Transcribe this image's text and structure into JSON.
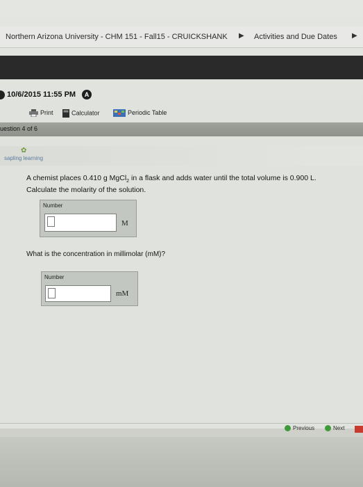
{
  "header": {
    "course": "Northern Arizona University - CHM 151 - Fall15 - CRUICKSHANK",
    "activities": "Activities and Due Dates"
  },
  "datebar": {
    "datetime": "10/6/2015 11:55 PM",
    "badge": "A"
  },
  "toolbar": {
    "print": "Print",
    "calculator": "Calculator",
    "periodic_table": "Periodic Table"
  },
  "question_bar": {
    "label": "uestion 4 of 6"
  },
  "brand": {
    "name": "sapling learning"
  },
  "problem": {
    "line1_pre": "A chemist places 0.410 g MgCl",
    "line1_sub": "2",
    "line1_post": " in a flask and adds water until the total volume is 0.900 L.",
    "line2": "Calculate the molarity of the solution."
  },
  "answer1": {
    "label": "Number",
    "unit": "M",
    "value": ""
  },
  "question2": "What is the concentration in millimolar (mM)?",
  "answer2": {
    "label": "Number",
    "unit": "mM",
    "value": ""
  },
  "footer_nav": {
    "previous": "Previous",
    "next": "Next"
  }
}
